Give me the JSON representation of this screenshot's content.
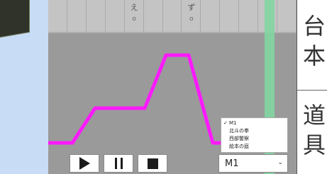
{
  "header": {
    "columns": [
      {
        "kana": "",
        "tick": ""
      },
      {
        "kana": "",
        "tick": ""
      },
      {
        "kana": "",
        "tick": ""
      },
      {
        "kana": "",
        "tick": ""
      },
      {
        "kana": "え",
        "tick": "o"
      },
      {
        "kana": "",
        "tick": ""
      },
      {
        "kana": "",
        "tick": ""
      },
      {
        "kana": "ず",
        "tick": "o"
      },
      {
        "kana": "",
        "tick": ""
      },
      {
        "kana": "",
        "tick": ""
      },
      {
        "kana": "",
        "tick": ""
      },
      {
        "kana": "",
        "tick": ""
      },
      {
        "kana": "",
        "tick": ""
      }
    ]
  },
  "curve": {
    "color": "#ff19ff"
  },
  "dropdown": {
    "items": [
      {
        "label": "M1",
        "selected": true
      },
      {
        "label": "北斗の拳",
        "selected": false
      },
      {
        "label": "西部警察",
        "selected": false
      },
      {
        "label": "絵本の庭",
        "selected": false
      }
    ],
    "check_glyph": "✓"
  },
  "select": {
    "value": "M1",
    "chevron": "⌄"
  },
  "right_panel": {
    "chars_top": [
      "台",
      "本"
    ],
    "chars_bottom": [
      "道",
      "具"
    ]
  }
}
